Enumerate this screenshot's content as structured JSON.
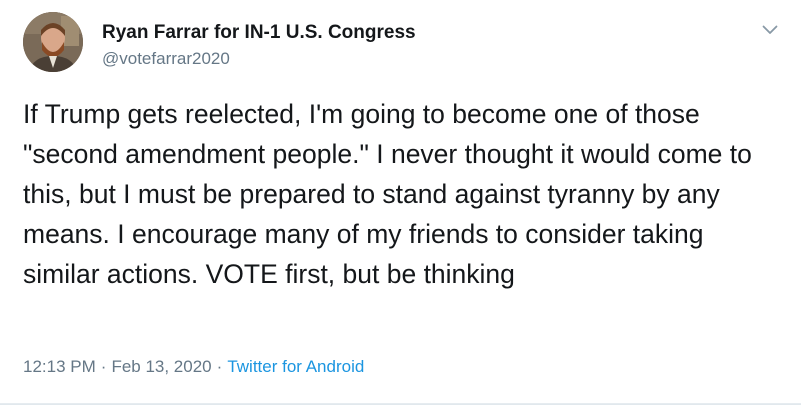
{
  "author": {
    "display_name": "Ryan Farrar for IN-1 U.S. Congress",
    "handle": "@votefarrar2020",
    "avatar_icon": "profile-photo"
  },
  "tweet": {
    "text": "If Trump gets reelected, I'm going to become one of those \"second amendment people.\" I never thought it would come to this, but I must be prepared to stand against tyranny by any means. I encourage many of my friends to consider taking similar actions. VOTE first, but be thinking"
  },
  "meta": {
    "time": "12:13 PM",
    "separator": "·",
    "date": "Feb 13, 2020",
    "source": "Twitter for Android"
  },
  "icons": {
    "more": "chevron-down-icon"
  },
  "colors": {
    "text": "#14171a",
    "secondary": "#657786",
    "link": "#1b95e0"
  }
}
